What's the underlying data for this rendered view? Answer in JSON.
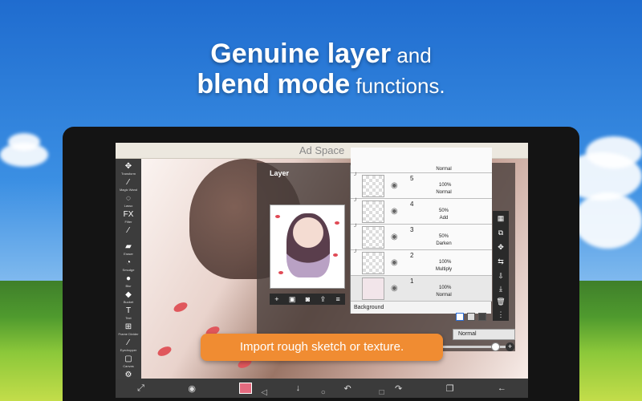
{
  "headline": {
    "line1_bold": "Genuine layer",
    "line1_rest": " and",
    "line2_bold": "blend mode",
    "line2_rest": " functions."
  },
  "ad_space": "Ad Space",
  "toolbar": {
    "tools": [
      {
        "icon": "move-icon",
        "glyph": "✥",
        "label": "Transform"
      },
      {
        "icon": "magic-wand-icon",
        "glyph": "⁄",
        "label": "Magic Wand"
      },
      {
        "icon": "lasso-icon",
        "glyph": "◌",
        "label": "Lasso"
      },
      {
        "icon": "filter-icon",
        "glyph": "FX",
        "label": "Filter"
      },
      {
        "icon": "brush-icon",
        "glyph": "⁄",
        "label": ""
      },
      {
        "icon": "eraser-icon",
        "glyph": "▰",
        "label": "Eraser"
      },
      {
        "icon": "smudge-icon",
        "glyph": "◔",
        "label": "Smudge"
      },
      {
        "icon": "blur-icon",
        "glyph": "●",
        "label": "Blur"
      },
      {
        "icon": "bucket-icon",
        "glyph": "◆",
        "label": "Bucket"
      },
      {
        "icon": "text-icon",
        "glyph": "T",
        "label": "Text"
      },
      {
        "icon": "frame-divider-icon",
        "glyph": "⊞",
        "label": "Frame Divider"
      },
      {
        "icon": "eyedropper-icon",
        "glyph": "⁄",
        "label": "Eyedropper"
      },
      {
        "icon": "canvas-icon",
        "glyph": "▢",
        "label": "Canvas"
      },
      {
        "icon": "settings-icon",
        "glyph": "⚙",
        "label": ""
      }
    ]
  },
  "layer_panel": {
    "title": "Layer",
    "top_mode": "Normal",
    "layers": [
      {
        "number": "5",
        "opacity": "100%",
        "mode": "Normal"
      },
      {
        "number": "4",
        "opacity": "50%",
        "mode": "Add"
      },
      {
        "number": "3",
        "opacity": "50%",
        "mode": "Darken"
      },
      {
        "number": "2",
        "opacity": "100%",
        "mode": "Multiply"
      },
      {
        "number": "1",
        "opacity": "100%",
        "mode": "Normal"
      }
    ],
    "background_label": "Background",
    "blend_mode": "Normal"
  },
  "callout": "Import rough sketch or texture."
}
